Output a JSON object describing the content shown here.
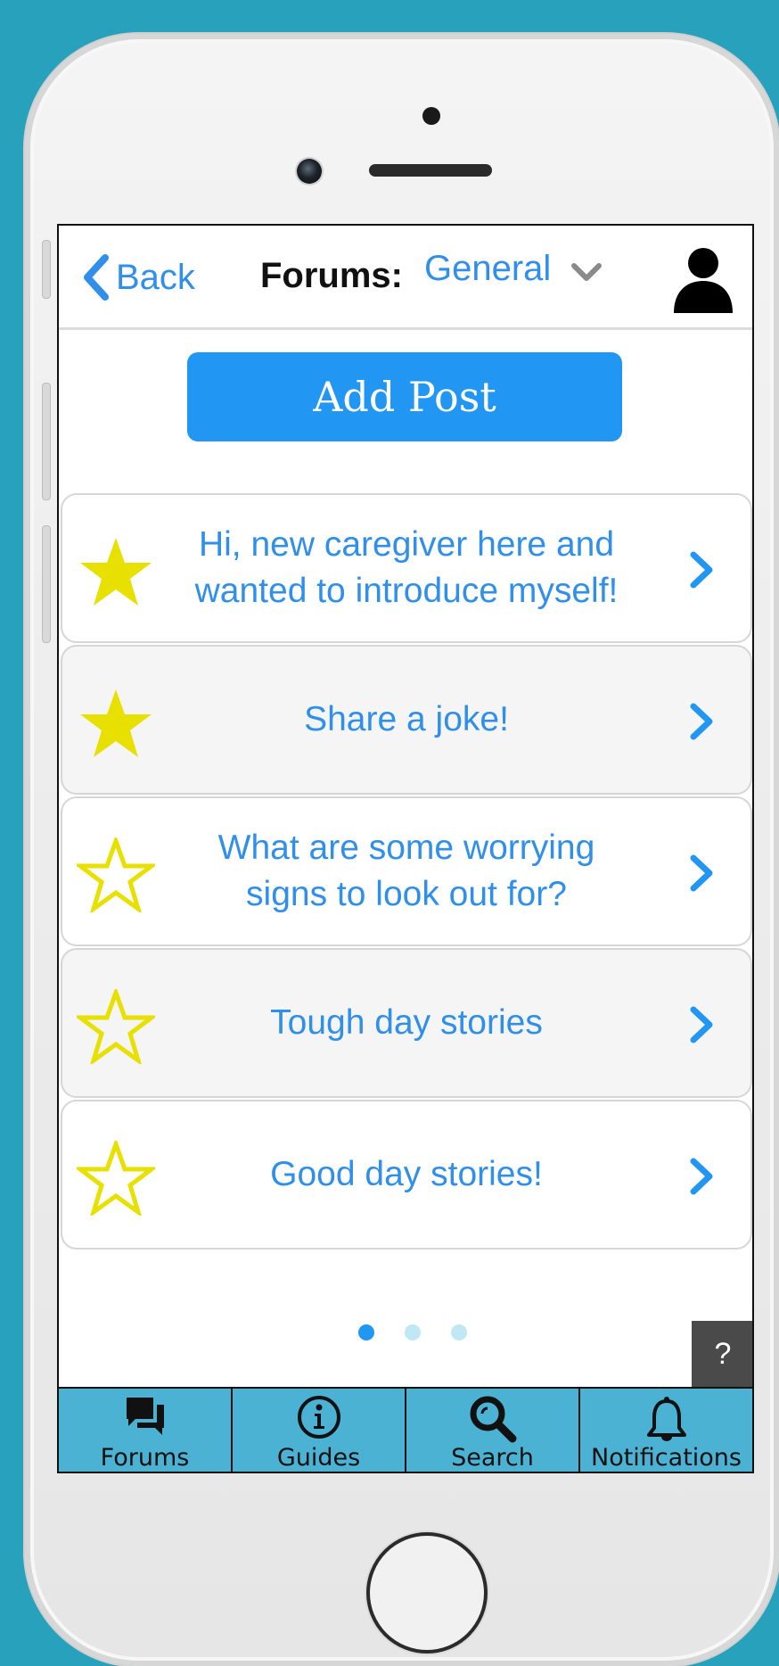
{
  "header": {
    "back_label": "Back",
    "forums_label": "Forums:",
    "category": "General"
  },
  "actions": {
    "add_post_label": "Add Post"
  },
  "posts": [
    {
      "title": "Hi, new caregiver here and\nwanted to introduce myself!",
      "starred": true
    },
    {
      "title": "Share a joke!",
      "starred": true
    },
    {
      "title": "What are some worrying\nsigns to look out for?",
      "starred": false
    },
    {
      "title": "Tough day stories",
      "starred": false
    },
    {
      "title": "Good day stories!",
      "starred": false
    }
  ],
  "pagination": {
    "pages": 3,
    "current": 1
  },
  "help_label": "?",
  "tabs": [
    {
      "label": "Forums",
      "icon": "chat-bubbles-icon",
      "active": true
    },
    {
      "label": "Guides",
      "icon": "info-icon",
      "active": false
    },
    {
      "label": "Search",
      "icon": "search-icon",
      "active": false
    },
    {
      "label": "Notifications",
      "icon": "bell-icon",
      "active": false
    }
  ],
  "colors": {
    "background": "#28a2bc",
    "accent": "#2196f3",
    "link": "#2f8fea",
    "star": "#e8e000",
    "tabbar": "#4cb2d4",
    "tabbar_active": "#2a86ad"
  }
}
